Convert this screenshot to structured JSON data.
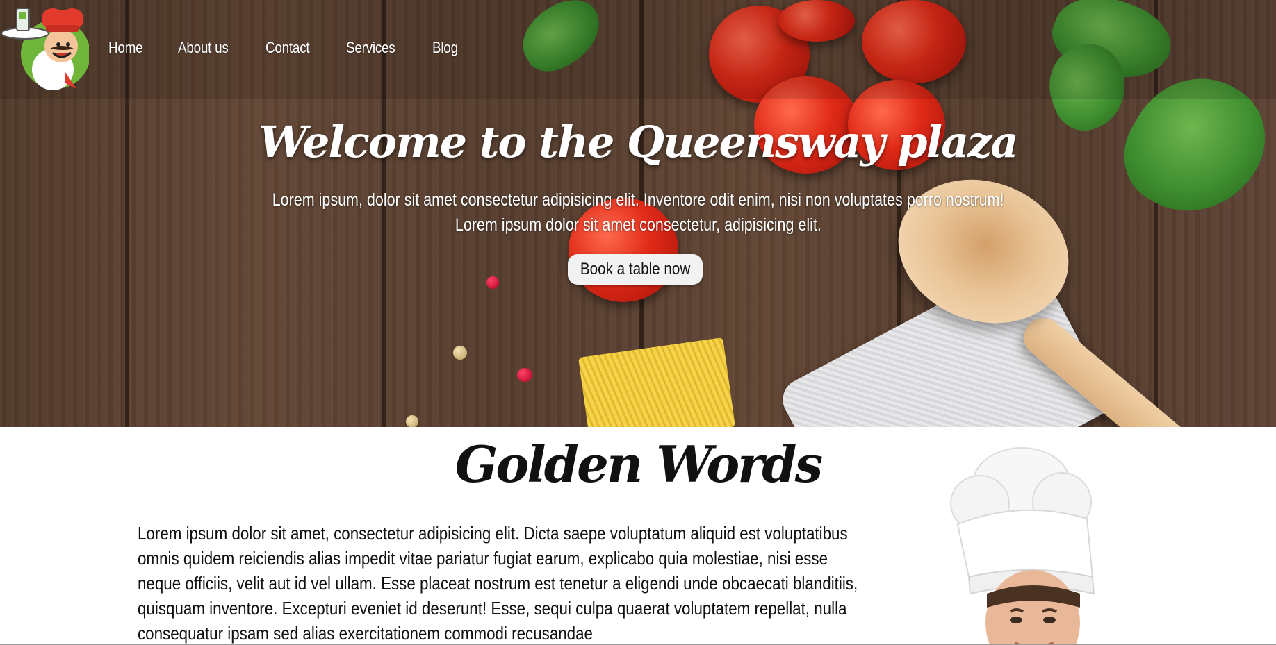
{
  "nav": {
    "logo_icon": "chef-mascot-icon",
    "items": [
      {
        "label": "Home"
      },
      {
        "label": "About us"
      },
      {
        "label": "Contact"
      },
      {
        "label": "Services"
      },
      {
        "label": "Blog"
      }
    ]
  },
  "hero": {
    "title": "Welcome to the Queensway plaza",
    "subtitle_line1": "Lorem ipsum, dolor sit amet consectetur adipisicing elit. Inventore odit enim, nisi non voluptates porro nostrum!",
    "subtitle_line2": "Lorem ipsum dolor sit amet consectetur, adipisicing elit.",
    "button_label": "Book a table now"
  },
  "golden": {
    "title": "Golden Words",
    "body": "Lorem ipsum dolor sit amet, consectetur adipisicing elit. Dicta saepe voluptatum aliquid est voluptatibus omnis quidem reiciendis alias impedit vitae pariatur fugiat earum, explicabo quia molestiae, nisi esse neque officiis, velit aut id vel ullam. Esse placeat nostrum est tenetur a eligendi unde obcaecati blanditiis, quisquam inventore. Excepturi eveniet id deserunt! Esse, sequi culpa quaerat voluptatem repellat, nulla consequatur ipsam sed alias exercitationem commodi recusandae",
    "chef_image_icon": "chef-portrait-image"
  }
}
